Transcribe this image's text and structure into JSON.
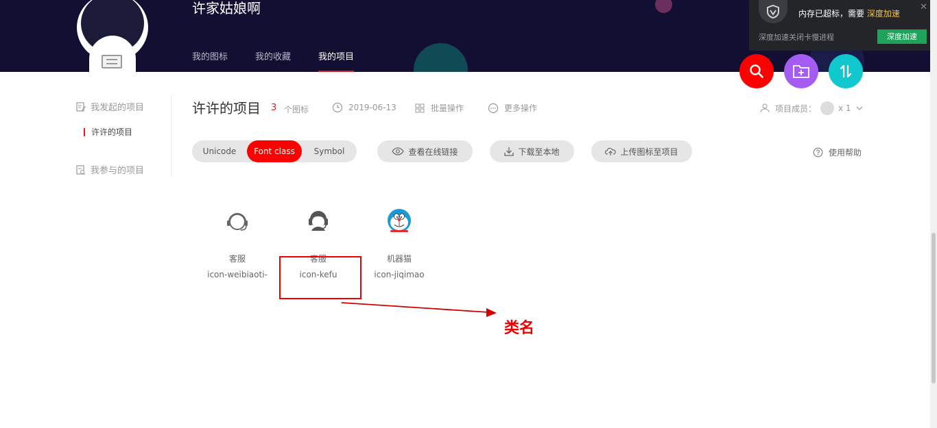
{
  "header": {
    "username": "许家姑娘啊",
    "tabs": [
      {
        "label": "我的图标",
        "active": false
      },
      {
        "label": "我的收藏",
        "active": false
      },
      {
        "label": "我的项目",
        "active": true
      }
    ]
  },
  "popup": {
    "title": "内存已超标，需要 ",
    "title_link": "深度加速",
    "subtitle": "深度加速关闭卡慢进程",
    "button": "深度加速",
    "close": "✕"
  },
  "sidebar": {
    "initiated_label": "我发起的项目",
    "project_label": "许许的项目",
    "joined_label": "我参与的项目"
  },
  "project": {
    "title": "许许的项目",
    "count": "3",
    "count_label": "个图标",
    "date": "2019-06-13",
    "batch_label": "批量操作",
    "more_label": "更多操作",
    "members_label": "项目成员：",
    "members_count": "x 1"
  },
  "toolbar": {
    "modes": [
      "Unicode",
      "Font class",
      "Symbol"
    ],
    "active_mode": "Font class",
    "view_link": "查看在线链接",
    "download": "下载至本地",
    "upload": "上传图标至项目",
    "help": "使用帮助"
  },
  "icons": [
    {
      "name": "客服",
      "class": "icon-weibiaoti-",
      "icon": "headset-outline-icon"
    },
    {
      "name": "客服",
      "class": "icon-kefu",
      "icon": "customer-service-icon"
    },
    {
      "name": "机器猫",
      "class": "icon-jiqimao",
      "icon": "doraemon-icon"
    }
  ],
  "annotation": {
    "label": "类名"
  },
  "colors": {
    "header_bg": "#130f33",
    "accent_red": "#ff0000",
    "fab_purple": "#a55cf2",
    "fab_teal": "#11c8cf",
    "popup_green": "#1fa35b"
  }
}
